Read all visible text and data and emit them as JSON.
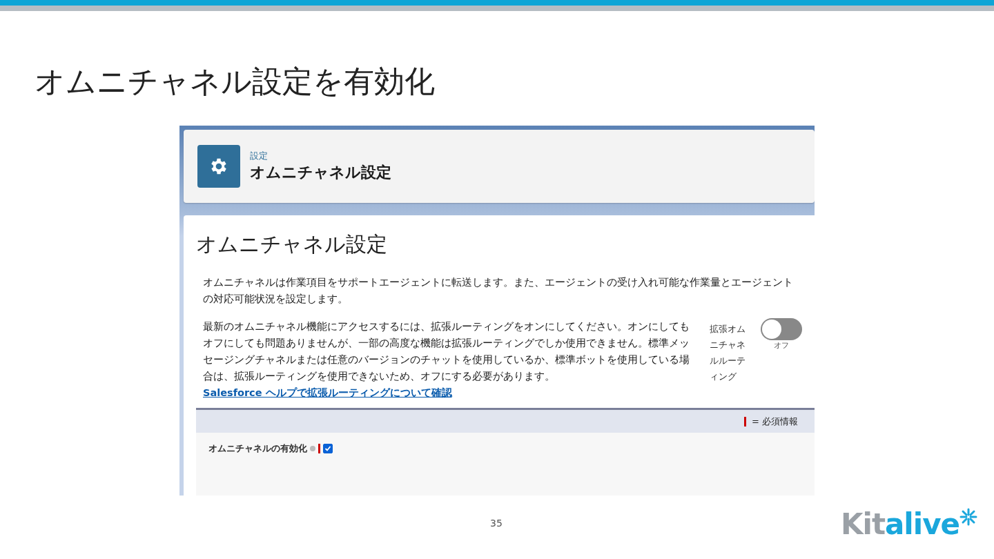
{
  "slide": {
    "title": "オムニチャネル設定を有効化",
    "page_number": "35",
    "logo": {
      "part_1": "Kit",
      "part_2": "alive"
    }
  },
  "screenshot": {
    "header": {
      "breadcrumb": "設定",
      "title": "オムニチャネル設定"
    },
    "heading": "オムニチャネル設定",
    "description": "オムニチャネルは作業項目をサポートエージェントに転送します。また、エージェントの受け入れ可能な作業量とエージェントの対応可能状況を設定します。",
    "routing_text": "最新のオムニチャネル機能にアクセスするには、拡張ルーティングをオンにしてください。オンにしてもオフにしても問題ありませんが、一部の高度な機能は拡張ルーティングでしか使用できません。標準メッセージングチャネルまたは任意のバージョンのチャットを使用しているか、標準ボットを使用している場合は、拡張ルーティングを使用できないため、オフにする必要があります。",
    "routing_link": "Salesforce ヘルプで拡張ルーティングについて確認",
    "toggle": {
      "label": "拡張オムニチャネルルーティング",
      "on": false,
      "state_text": "オフ"
    },
    "required_legend": "= 必須情報",
    "field": {
      "label": "オムニチャネルの有効化",
      "checked": true
    }
  }
}
